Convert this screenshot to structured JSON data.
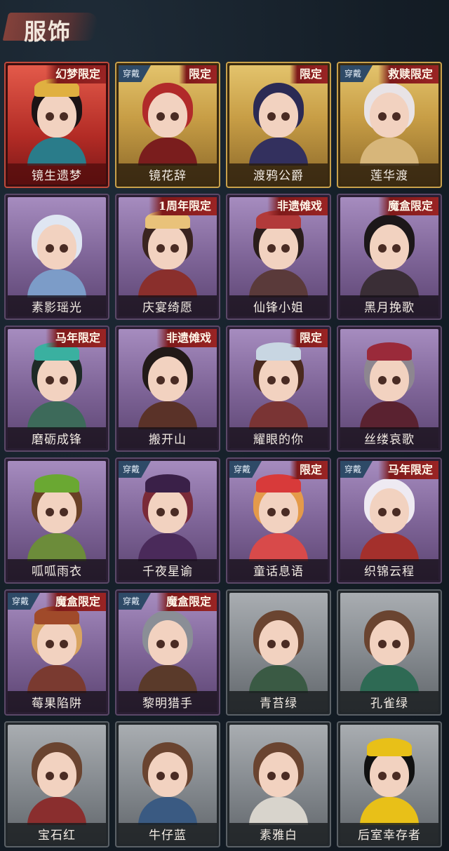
{
  "page": {
    "title": "服饰"
  },
  "labels": {
    "worn": "穿戴"
  },
  "rarity_colors": {
    "red": "#c04a3c",
    "gold": "#c9a14b",
    "purple": "#7f6598",
    "grey": "#858a8f"
  },
  "cards": [
    {
      "name": "镜生遗梦",
      "rarity": "red",
      "tag": "幻梦限定",
      "worn": false,
      "hair": "#1b1315",
      "body": "#2a7c8a",
      "accent": "#e0b040"
    },
    {
      "name": "镜花辞",
      "rarity": "gold",
      "tag": "限定",
      "worn": true,
      "hair": "#b12a2a",
      "body": "#7a1d1d",
      "accent": ""
    },
    {
      "name": "渡鸦公爵",
      "rarity": "gold",
      "tag": "限定",
      "worn": false,
      "hair": "#2b2a54",
      "body": "#33305e",
      "accent": ""
    },
    {
      "name": "莲华渡",
      "rarity": "gold",
      "tag": "救赎限定",
      "worn": true,
      "hair": "#e8e3e6",
      "body": "#d7b67a",
      "accent": ""
    },
    {
      "name": "素影瑶光",
      "rarity": "purple",
      "tag": "",
      "worn": false,
      "hair": "#dfe6f2",
      "body": "#7c9cc8",
      "accent": ""
    },
    {
      "name": "庆宴绮愿",
      "rarity": "purple",
      "tag": "1周年限定",
      "worn": false,
      "hair": "#3a2420",
      "body": "#8a2f2c",
      "accent": "#e9c27a"
    },
    {
      "name": "仙锋小姐",
      "rarity": "purple",
      "tag": "非遗傩戏",
      "worn": false,
      "hair": "#2a1d1b",
      "body": "#5a3a3a",
      "accent": "#b23a3a"
    },
    {
      "name": "黑月挽歌",
      "rarity": "purple",
      "tag": "魔盒限定",
      "worn": false,
      "hair": "#1c1719",
      "body": "#3a2e36",
      "accent": ""
    },
    {
      "name": "磨砺成锋",
      "rarity": "purple",
      "tag": "马年限定",
      "worn": false,
      "hair": "#1e2a26",
      "body": "#3d6a5a",
      "accent": "#3ab0a0"
    },
    {
      "name": "搬开山",
      "rarity": "purple",
      "tag": "非遗傩戏",
      "worn": false,
      "hair": "#221a18",
      "body": "#5a3228",
      "accent": ""
    },
    {
      "name": "耀眼的你",
      "rarity": "purple",
      "tag": "限定",
      "worn": false,
      "hair": "#4a2a1e",
      "body": "#7a3434",
      "accent": "#c8d6e2"
    },
    {
      "name": "丝缕哀歌",
      "rarity": "purple",
      "tag": "",
      "worn": false,
      "hair": "#8d8690",
      "body": "#5a2230",
      "accent": "#9a2a3a"
    },
    {
      "name": "呱呱雨衣",
      "rarity": "purple",
      "tag": "",
      "worn": false,
      "hair": "#6a4026",
      "body": "#6c8c3a",
      "accent": "#6aa832"
    },
    {
      "name": "千夜星谕",
      "rarity": "purple",
      "tag": "",
      "worn": true,
      "hair": "#7a2a38",
      "body": "#4a2a5a",
      "accent": "#3a2048"
    },
    {
      "name": "童话息语",
      "rarity": "purple",
      "tag": "限定",
      "worn": true,
      "hair": "#e49a4a",
      "body": "#d84a4a",
      "accent": "#d83a3a"
    },
    {
      "name": "织锦云程",
      "rarity": "purple",
      "tag": "马年限定",
      "worn": true,
      "hair": "#eeeaf2",
      "body": "#a4302c",
      "accent": ""
    },
    {
      "name": "莓果陷阱",
      "rarity": "purple",
      "tag": "魔盒限定",
      "worn": true,
      "hair": "#d8a460",
      "body": "#7a3a30",
      "accent": "#a04a2a"
    },
    {
      "name": "黎明猎手",
      "rarity": "purple",
      "tag": "魔盒限定",
      "worn": true,
      "hair": "#8a8e96",
      "body": "#5a3a2a",
      "accent": ""
    },
    {
      "name": "青苔绿",
      "rarity": "grey",
      "tag": "",
      "worn": false,
      "hair": "#6a4430",
      "body": "#3a5a44",
      "accent": ""
    },
    {
      "name": "孔雀绿",
      "rarity": "grey",
      "tag": "",
      "worn": false,
      "hair": "#6a4430",
      "body": "#2e6a54",
      "accent": ""
    },
    {
      "name": "宝石红",
      "rarity": "grey",
      "tag": "",
      "worn": false,
      "hair": "#6a4430",
      "body": "#8a2e2e",
      "accent": ""
    },
    {
      "name": "牛仔蓝",
      "rarity": "grey",
      "tag": "",
      "worn": false,
      "hair": "#6a4430",
      "body": "#3a5a82",
      "accent": ""
    },
    {
      "name": "素雅白",
      "rarity": "grey",
      "tag": "",
      "worn": false,
      "hair": "#6a4430",
      "body": "#d8d4cc",
      "accent": ""
    },
    {
      "name": "后室幸存者",
      "rarity": "grey",
      "tag": "",
      "worn": false,
      "hair": "#111111",
      "body": "#e8c018",
      "accent": "#e8c018"
    }
  ]
}
